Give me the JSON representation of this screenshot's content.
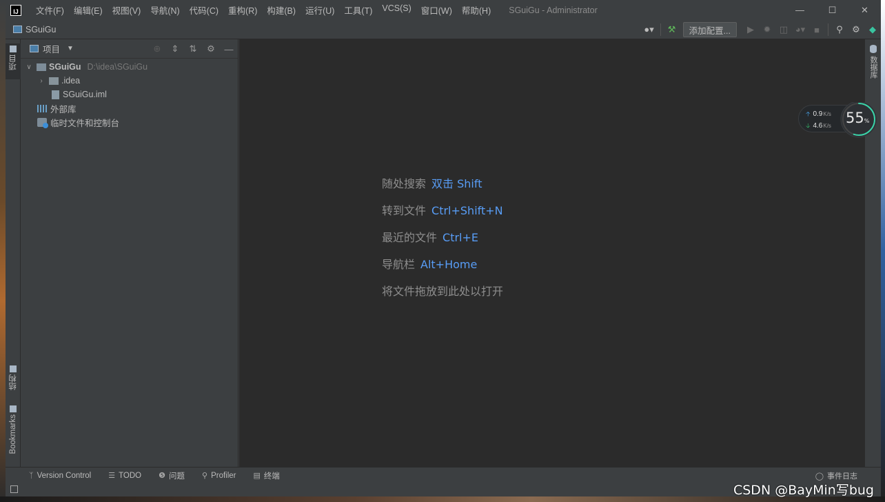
{
  "window": {
    "app_logo": "IJ",
    "title": "SGuiGu - Administrator",
    "menu": [
      "文件(F)",
      "编辑(E)",
      "视图(V)",
      "导航(N)",
      "代码(C)",
      "重构(R)",
      "构建(B)",
      "运行(U)",
      "工具(T)",
      "VCS(S)",
      "窗口(W)",
      "帮助(H)"
    ],
    "controls": {
      "minimize": "—",
      "maximize": "☐",
      "close": "✕"
    }
  },
  "navbar": {
    "breadcrumb": "SGuiGu",
    "config_button": "添加配置..."
  },
  "left_strip": {
    "project_tab": "项目",
    "structure_tab": "结构",
    "bookmarks_tab": "Bookmarks"
  },
  "project_panel": {
    "title": "项目",
    "tree": [
      {
        "label": "SGuiGu",
        "path": "D:\\idea\\SGuiGu",
        "expanded": true
      },
      {
        "label": ".idea",
        "expanded": false
      },
      {
        "label": "SGuiGu.iml"
      },
      {
        "label": "外部库"
      },
      {
        "label": "临时文件和控制台"
      }
    ]
  },
  "editor": {
    "hints": [
      {
        "text": "随处搜索",
        "key": "双击 Shift"
      },
      {
        "text": "转到文件",
        "key": "Ctrl+Shift+N"
      },
      {
        "text": "最近的文件",
        "key": "Ctrl+E"
      },
      {
        "text": "导航栏",
        "key": "Alt+Home"
      },
      {
        "text": "将文件拖放到此处以打开",
        "key": ""
      }
    ]
  },
  "right_strip": {
    "database_tab": "数据库"
  },
  "statusbar": {
    "items": [
      "Version Control",
      "TODO",
      "问题",
      "Profiler",
      "终端"
    ],
    "event_log": "事件日志"
  },
  "net_widget": {
    "upload": "0.9",
    "download": "4.6",
    "unit": "K/s",
    "percent": "55",
    "percent_sign": "%",
    "percent_value": 0.55
  },
  "watermark": "CSDN @BayMin写bug",
  "colors": {
    "accent_key": "#589df6",
    "editor_bg": "#2b2b2b",
    "chrome_bg": "#3c3f41"
  }
}
